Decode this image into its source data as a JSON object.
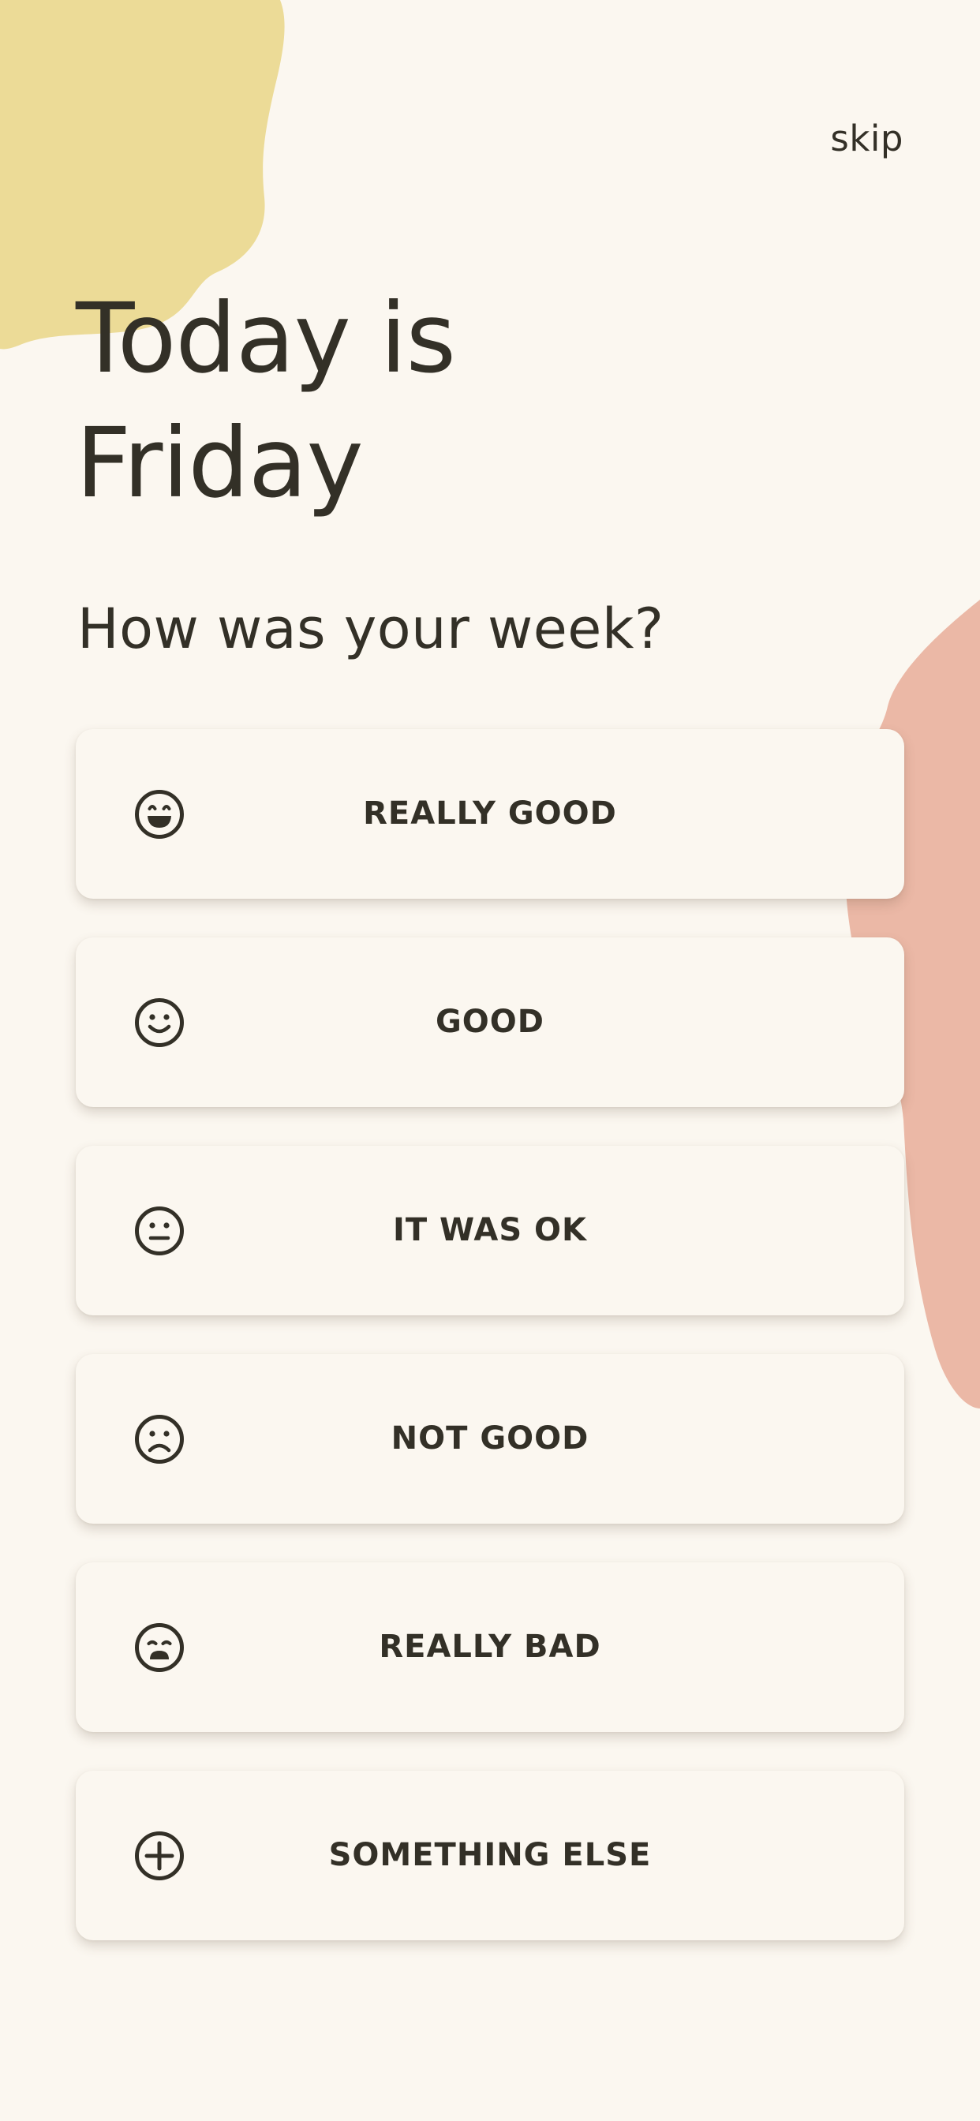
{
  "header": {
    "skip_label": "skip"
  },
  "title": {
    "line1": "Today is",
    "line2": "Friday"
  },
  "subtitle": "How was your week?",
  "options": [
    {
      "label": "REALLY GOOD",
      "icon": "grinning-face-icon"
    },
    {
      "label": "GOOD",
      "icon": "smiling-face-icon"
    },
    {
      "label": "IT WAS OK",
      "icon": "neutral-face-icon"
    },
    {
      "label": "NOT GOOD",
      "icon": "frowning-face-icon"
    },
    {
      "label": "REALLY BAD",
      "icon": "sad-face-icon"
    },
    {
      "label": "SOMETHING ELSE",
      "icon": "plus-circle-icon"
    }
  ],
  "colors": {
    "background": "#fbf7f0",
    "text": "#333027",
    "yellow_blob": "#ecdb97",
    "pink_blob": "#ebb8a6"
  }
}
